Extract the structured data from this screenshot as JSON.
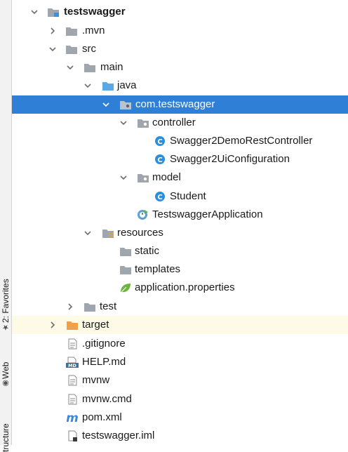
{
  "side_tabs": {
    "favorites": "2: Favorites",
    "web": "Web",
    "structure": "tructure"
  },
  "tree": {
    "root": "testswagger",
    "mvn": ".mvn",
    "src": "src",
    "main": "main",
    "java": "java",
    "package": "com.testswagger",
    "controller": "controller",
    "rest_controller": "Swagger2DemoRestController",
    "ui_configuration": "Swagger2UiConfiguration",
    "model": "model",
    "student": "Student",
    "application": "TestswaggerApplication",
    "resources": "resources",
    "static": "static",
    "templates": "templates",
    "properties": "application.properties",
    "test": "test",
    "target": "target",
    "gitignore": ".gitignore",
    "help": "HELP.md",
    "mvnw": "mvnw",
    "mvnw_cmd": "mvnw.cmd",
    "pom": "pom.xml",
    "iml": "testswagger.iml"
  },
  "icons": {
    "java_class_letter": "C",
    "markdown_badge": "MD",
    "maven_letter": "m"
  },
  "colors": {
    "selection": "#2f7fd6",
    "folder": "#9fa6ae",
    "source_folder": "#5aa9e6",
    "excluded_folder": "#f0a04b",
    "class_icon": "#2c8fdc",
    "spring": "#6db33f"
  }
}
